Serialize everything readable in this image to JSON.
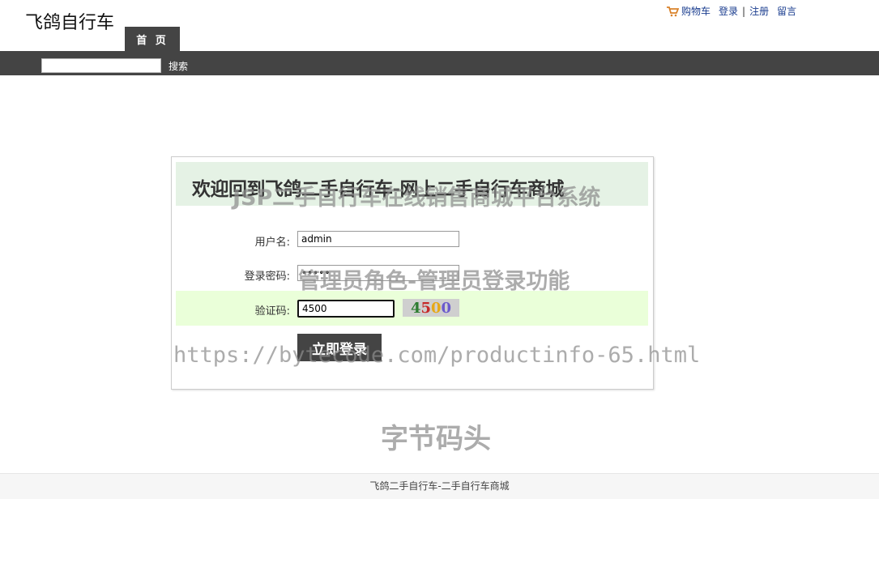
{
  "header": {
    "logo": "飞鸽自行车",
    "nav": {
      "cart": "购物车",
      "login": "登录",
      "separator": "|",
      "register": "注册",
      "message": "留言"
    },
    "tab_home": "首 页",
    "search_button": "搜索",
    "search_value": ""
  },
  "login": {
    "title": "欢迎回到飞鸽二手自行车-网上二手自行车商城",
    "username_label": "用户名:",
    "username_value": "admin",
    "password_label": "登录密码:",
    "password_value": "•••••",
    "captcha_label": "验证码:",
    "captcha_value": "4500",
    "captcha_image": {
      "chars": [
        "4",
        "5",
        "0",
        "0"
      ],
      "colors": [
        "#2e7d32",
        "#c62828",
        "#e6a817",
        "#6a5acd"
      ]
    },
    "submit_label": "立即登录"
  },
  "watermarks": {
    "line1": "JSP二手自行车在线销售商城平台系统",
    "line2": "管理员角色-管理员登录功能",
    "line3": "https://bytecode.com/productinfo-65.html",
    "line4": "字节码头"
  },
  "footer": {
    "text": "飞鸽二手自行车-二手自行车商城"
  },
  "colors": {
    "nav_bar": "#444444",
    "title_bar": "#e5f2e5",
    "captcha_row": "#eaffd9",
    "link": "#1a3d8f"
  }
}
